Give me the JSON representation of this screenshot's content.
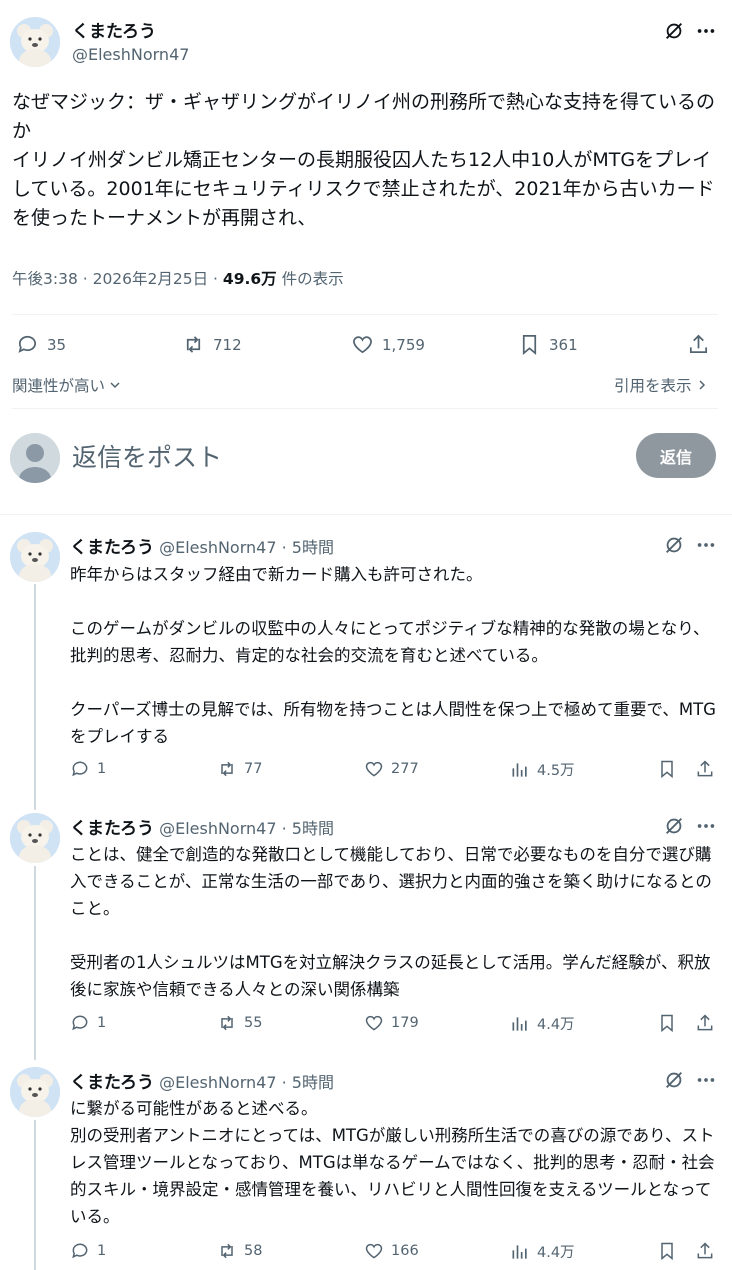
{
  "main_tweet": {
    "author_name": "くまたろう",
    "author_handle": "@EleshNorn47",
    "text": "なぜマジック：ザ・ギャザリングがイリノイ州の刑務所で熱心な支持を得ているのか\nイリノイ州ダンビル矯正センターの長期服役囚人たち12人中10人がMTGをプレイしている。2001年にセキュリティリスクで禁止されたが、2021年から古いカードを使ったトーナメントが再開され、",
    "timestamp": "午後3:38 · 2026年2月25日 · ",
    "views_count": "49.6万",
    "views_label": " 件の表示",
    "replies": "35",
    "reposts": "712",
    "likes": "1,759",
    "bookmarks": "361"
  },
  "filters": {
    "relevance_label": "関連性が高い",
    "quotes_label": "引用を表示"
  },
  "composer": {
    "placeholder": "返信をポスト",
    "button_label": "返信"
  },
  "replies": [
    {
      "name": "くまたろう",
      "handle": "@EleshNorn47",
      "time": " · 5時間",
      "text": "昨年からはスタッフ経由で新カード購入も許可された。\n\nこのゲームがダンビルの収監中の人々にとってポジティブな精神的な発散の場となり、批判的思考、忍耐力、肯定的な社会的交流を育むと述べている。\n\nクーパーズ博士の見解では、所有物を持つことは人間性を保つ上で極めて重要で、MTGをプレイする",
      "replies": "1",
      "reposts": "77",
      "likes": "277",
      "views": "4.5万"
    },
    {
      "name": "くまたろう",
      "handle": "@EleshNorn47",
      "time": " · 5時間",
      "text": "ことは、健全で創造的な発散口として機能しており、日常で必要なものを自分で選び購入できることが、正常な生活の一部であり、選択力と内面的強さを築く助けになるとのこと。\n\n受刑者の1人シュルツはMTGを対立解決クラスの延長として活用。学んだ経験が、釈放後に家族や信頼できる人々との深い関係構築",
      "replies": "1",
      "reposts": "55",
      "likes": "179",
      "views": "4.4万"
    },
    {
      "name": "くまたろう",
      "handle": "@EleshNorn47",
      "time": " · 5時間",
      "text": "に繋がる可能性があると述べる。\n別の受刑者アントニオにとっては、MTGが厳しい刑務所生活での喜びの源であり、ストレス管理ツールとなっており、MTGは単なるゲームではなく、批判的思考・忍耐・社会的スキル・境界設定・感情管理を養い、リハビリと人間性回復を支えるツールとなっている。",
      "replies": "1",
      "reposts": "58",
      "likes": "166",
      "views": "4.4万"
    }
  ]
}
